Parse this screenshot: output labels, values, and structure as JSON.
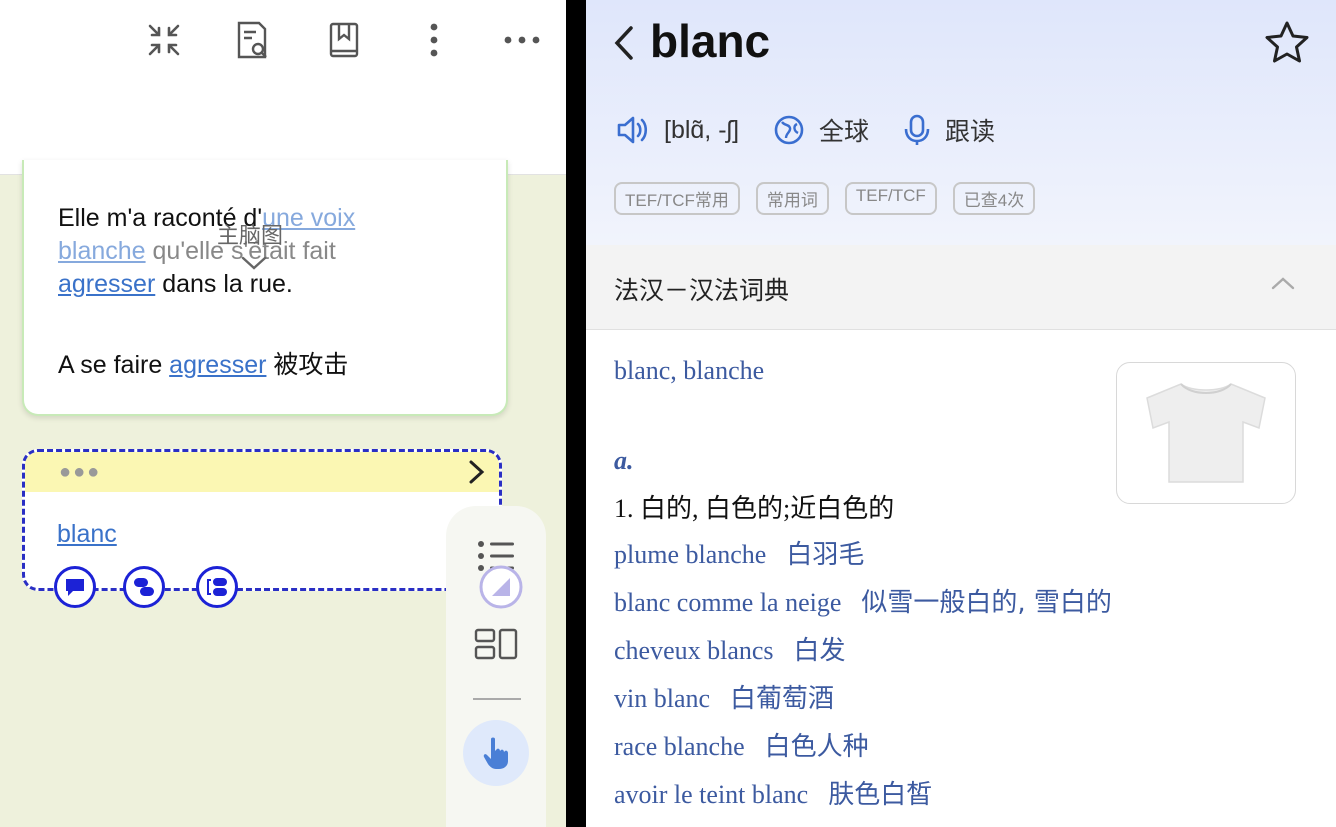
{
  "left": {
    "note": {
      "line1_part1": "Elle m'a raconté d'",
      "line1_link": "une voix",
      "line2_link": "blanche",
      "line2_rest": " qu'elle s'était fait",
      "line3_link": "agresser",
      "line3_rest": " dans la rue.",
      "translation_prefix": "A se faire ",
      "translation_link": "agresser",
      "translation_suffix": " 被攻击",
      "mindmap_label": "主脑图"
    },
    "card2": {
      "dots": "●●●",
      "word": "blanc"
    }
  },
  "right": {
    "word": "blanc",
    "pronunciation": "[blɑ̃, -ʃ]",
    "region": "全球",
    "read_along": "跟读",
    "tags": [
      "TEF/TCF常用",
      "常用词",
      "TEF/TCF",
      "已查4次"
    ],
    "dict_title": "法汉－汉法词典",
    "headword": "blanc, blanche",
    "pos": "a.",
    "definition": "1. 白的, 白色的;近白色的",
    "examples": [
      {
        "fr": "plume blanche",
        "zh": "白羽毛"
      },
      {
        "fr": "blanc comme la neige",
        "zh": "似雪一般白的, 雪白的"
      },
      {
        "fr": "cheveux blancs",
        "zh": "白发"
      },
      {
        "fr": "vin blanc",
        "zh": "白葡萄酒"
      },
      {
        "fr": "race blanche",
        "zh": "白色人种"
      },
      {
        "fr": "avoir le teint blanc",
        "zh": "肤色白皙"
      }
    ]
  },
  "colors": {
    "accent_blue": "#3a72c9",
    "dict_blue": "#3c5aa0",
    "card_border": "#2a2fc4",
    "note_border": "#c8eab8",
    "card_header": "#fbf7b3"
  }
}
